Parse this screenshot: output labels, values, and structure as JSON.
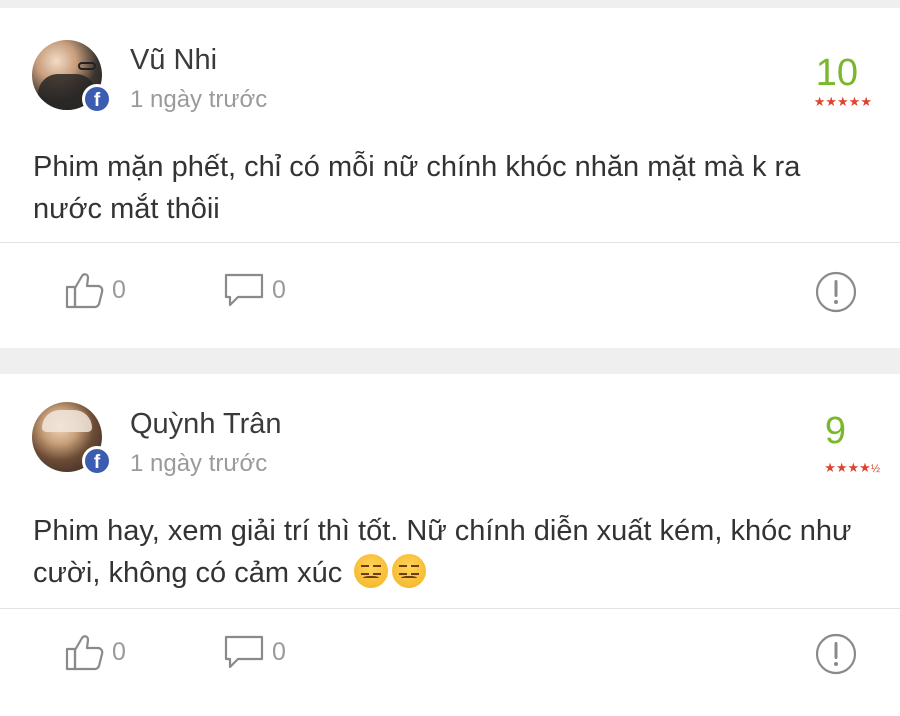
{
  "reviews": [
    {
      "name": "Vũ Nhi",
      "time": "1 ngày trước",
      "score": "10",
      "stars": "★★★★★",
      "half": "",
      "comment": "Phim mặn phết, chỉ có mỗi nữ chính khóc nhăn mặt mà k ra nước mắt thôii",
      "likes": "0",
      "replies": "0",
      "source_icon": "facebook-icon"
    },
    {
      "name": "Quỳnh Trân",
      "time": "1 ngày trước",
      "score": "9",
      "stars": "★★★★",
      "half": "½",
      "comment": "Phim hay, xem giải trí thì tốt. Nữ chính diễn xuất kém, khóc như cười, không có cảm xúc",
      "likes": "0",
      "replies": "0",
      "source_icon": "facebook-icon"
    }
  ],
  "colors": {
    "score": "#79b72b",
    "stars": "#e0432f",
    "facebook": "#3b5cb0",
    "background": "#efefef"
  }
}
